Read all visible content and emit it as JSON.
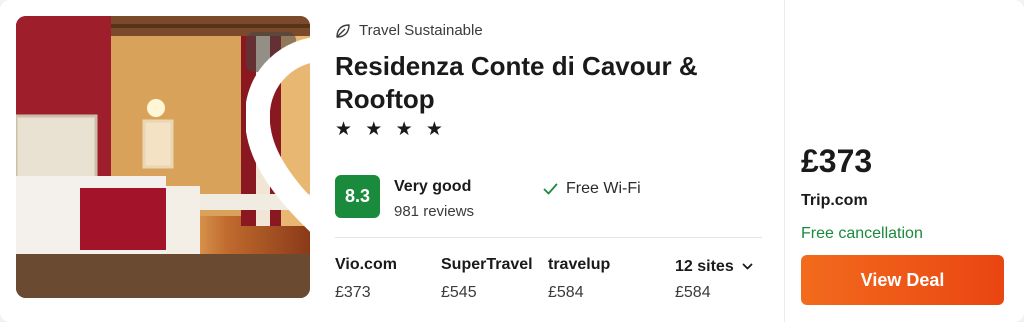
{
  "photo": {
    "alt_icon": "hotel-room-photo"
  },
  "badge": {
    "label": "Travel Sustainable",
    "icon": "leaf-icon"
  },
  "hotel": {
    "name": "Residenza Conte di Cavour & Rooftop",
    "stars": "★ ★ ★ ★"
  },
  "rating": {
    "score": "8.3",
    "label": "Very good",
    "reviews": "981 reviews",
    "color": "#1a8a3c"
  },
  "amenities": [
    {
      "label": "Free Wi-Fi",
      "icon": "check-icon"
    }
  ],
  "sites": [
    {
      "name": "Vio.com",
      "price": "£373"
    },
    {
      "name": "SuperTravel",
      "price": "£545"
    },
    {
      "name": "travelup",
      "price": "£584"
    }
  ],
  "more_sites": {
    "label": "12 sites",
    "price": "£584",
    "icon": "chevron-down-icon"
  },
  "deal": {
    "price": "£373",
    "provider": "Trip.com",
    "cancellation": "Free cancellation",
    "button": "View Deal",
    "button_color": "#f26b1d"
  },
  "favorite": {
    "icon": "heart-icon"
  }
}
